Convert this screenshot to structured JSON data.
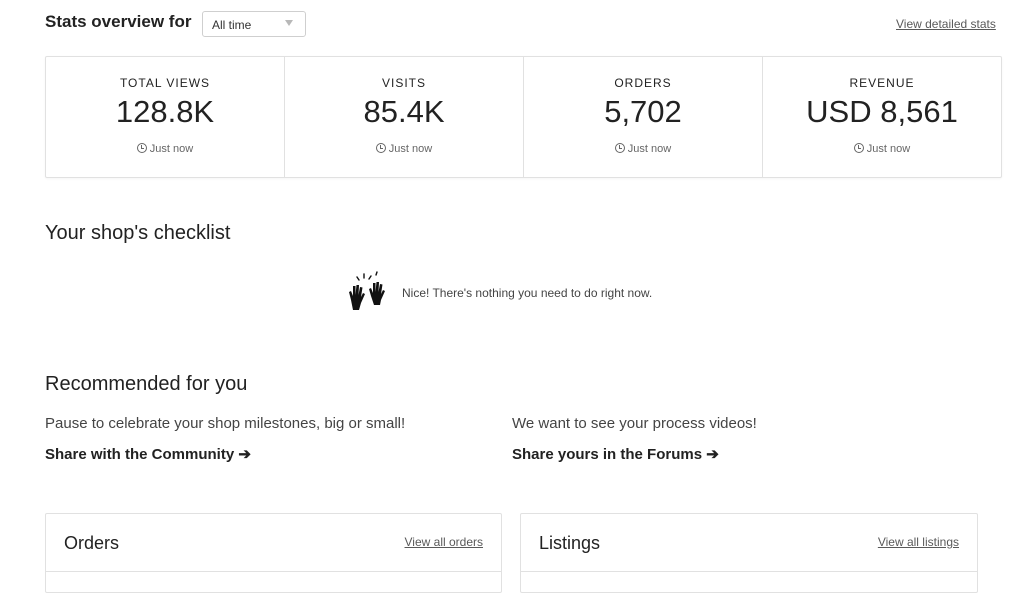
{
  "header": {
    "title": "Stats overview for",
    "range_selected": "All time",
    "detail_link": "View detailed stats"
  },
  "stats": [
    {
      "label": "TOTAL VIEWS",
      "value": "128.8K",
      "time": "Just now"
    },
    {
      "label": "VISITS",
      "value": "85.4K",
      "time": "Just now"
    },
    {
      "label": "ORDERS",
      "value": "5,702",
      "time": "Just now"
    },
    {
      "label": "REVENUE",
      "value": "USD 8,561",
      "time": "Just now"
    }
  ],
  "checklist": {
    "title": "Your shop's checklist",
    "message": "Nice! There's nothing you need to do right now.",
    "icon": "clapping-hands-icon"
  },
  "recommended": {
    "title": "Recommended for you",
    "items": [
      {
        "text": "Pause to celebrate your shop milestones, big or small!",
        "link": "Share with the Community ➔"
      },
      {
        "text": "We want to see your process videos!",
        "link": "Share yours in the Forums ➔"
      }
    ]
  },
  "cards": {
    "orders": {
      "title": "Orders",
      "link": "View all orders"
    },
    "listings": {
      "title": "Listings",
      "link": "View all listings"
    }
  }
}
